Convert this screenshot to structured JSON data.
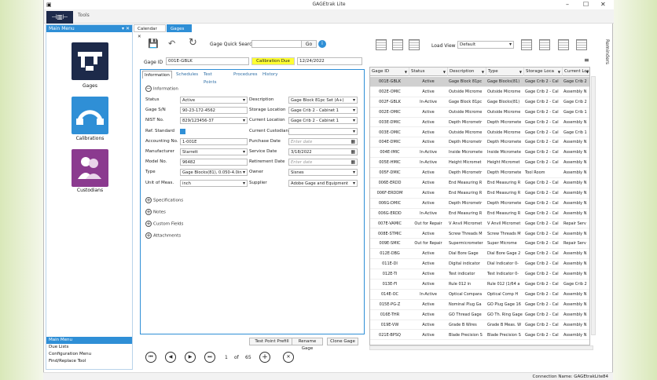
{
  "window": {
    "title": "GAGEtrak Lite",
    "minimize": "–",
    "maximize": "☐",
    "close": "✕"
  },
  "ribbon": {
    "tools_label": "Tools",
    "logo_glyph": "⊣▥⊢"
  },
  "main_menu": {
    "title": "Main Menu",
    "pin": "▾ ✕",
    "tiles": [
      {
        "label": "Gages",
        "color": "#1d2a4a"
      },
      {
        "label": "Calibrations",
        "color": "#2f8fd6"
      },
      {
        "label": "Custodians",
        "color": "#8b3a8f"
      }
    ],
    "links": [
      {
        "label": "Main Menu",
        "selected": true
      },
      {
        "label": "Due Lists"
      },
      {
        "label": "Configuration Menu"
      },
      {
        "label": "Find/Replace Tool"
      }
    ]
  },
  "doc_tabs": [
    {
      "label": "Calendar",
      "close": "✕"
    },
    {
      "label": "Gages",
      "close": "✕"
    }
  ],
  "toolbar": {
    "quick_search_label": "Gage Quick Search",
    "go_label": "Go",
    "info": "i",
    "load_view_label": "Load View",
    "load_view_value": "Default"
  },
  "header": {
    "gage_id_label": "Gage ID",
    "gage_id_value": "001E-GBLK",
    "cal_due_label": "Calibration Due",
    "cal_due_date": "12/24/2022"
  },
  "sub_tabs": [
    "Information",
    "Schedules",
    "Test Points",
    "Procedures",
    "History"
  ],
  "info_section": "Information",
  "fields_left": [
    {
      "label": "Status",
      "value": "Active",
      "kind": "sel"
    },
    {
      "label": "Gage S/N",
      "value": "90-23-172-4562",
      "kind": "txt"
    },
    {
      "label": "NIST No.",
      "value": "829/123456-37",
      "kind": "sel"
    },
    {
      "label": "Ref. Standard",
      "value": "",
      "kind": "chk"
    },
    {
      "label": "Accounting No.",
      "value": "1-001E",
      "kind": "txt"
    },
    {
      "label": "Manufacturer",
      "value": "Starrett",
      "kind": "sel"
    },
    {
      "label": "Model No.",
      "value": "96482",
      "kind": "txt"
    },
    {
      "label": "Type",
      "value": "Gage Blocks(81), 0.050-4.0in",
      "kind": "sel"
    },
    {
      "label": "Unit of Meas.",
      "value": "inch",
      "kind": "sel"
    }
  ],
  "fields_right": [
    {
      "label": "Description",
      "value": "Gage Block 81pc Set (A+)",
      "kind": "sel"
    },
    {
      "label": "Storage Location",
      "value": "Gage Crib 2 - Cabinet 1",
      "kind": "sel"
    },
    {
      "label": "Current Location",
      "value": "Gage Crib 2 - Cabinet 1",
      "kind": "sel"
    },
    {
      "label": "Current Custodian",
      "value": "",
      "kind": "sel"
    },
    {
      "label": "Purchase Date",
      "value": "Enter date",
      "kind": "dtph"
    },
    {
      "label": "Service Date",
      "value": "3/18/2022",
      "kind": "dt"
    },
    {
      "label": "Retirement Date",
      "value": "Enter date",
      "kind": "dtph"
    },
    {
      "label": "Owner",
      "value": "Sisnes",
      "kind": "sel"
    },
    {
      "label": "Supplier",
      "value": "Adobe Gage and Equipment",
      "kind": "sel"
    }
  ],
  "collapsed_sections": [
    "Specifications",
    "Notes",
    "Custom Fields",
    "Attachments"
  ],
  "bottom_buttons": [
    "Test Point Prefill",
    "Rename Gage",
    "Clone Gage"
  ],
  "pager": {
    "first": "⏮",
    "prev": "◀",
    "next": "▶",
    "last": "⏭",
    "current": "1",
    "of_label": "of",
    "total": "65",
    "add": "+",
    "delete": "✕"
  },
  "grid": {
    "columns": [
      "Gage ID",
      "Status",
      "Description",
      "Type",
      "Storage Loca",
      "Current Loc"
    ],
    "filter_glyph": "▼",
    "rows": [
      [
        "001E-GBLK",
        "Active",
        "Gage Block 81pc",
        "Gage Blocks(81)",
        "Gage Crib 2 - Cal",
        "Gage Crib 2"
      ],
      [
        "002E-OMIC",
        "Active",
        "Outside Microme",
        "Outside Microme",
        "Gage Crib 2 - Cal",
        "Assembly N"
      ],
      [
        "002F-GBLK",
        "In-Active",
        "Gage Block 81pc",
        "Gage Blocks(81)",
        "Gage Crib 2 - Cal",
        "Gage Crib 2"
      ],
      [
        "002E-OMIC",
        "Active",
        "Outside Microme",
        "Outside Microme",
        "Gage Crib 2 - Cal",
        "Gage Crib 1"
      ],
      [
        "003E-DMIC",
        "Active",
        "Depth Micrometr",
        "Depth Micromete",
        "Gage Crib 2 - Cal",
        "Assembly N"
      ],
      [
        "003E-OMIC",
        "Active",
        "Outside Microme",
        "Outside Microme",
        "Gage Crib 2 - Cal",
        "Gage Crib 1"
      ],
      [
        "004E-DMIC",
        "Active",
        "Depth Micrometr",
        "Depth Micromete",
        "Gage Crib 2 - Cal",
        "Assembly N"
      ],
      [
        "004E-IMIC",
        "In-Active",
        "Inside Micromete",
        "Inside Micromete",
        "Gage Crib 2 - Cal",
        "Assembly N"
      ],
      [
        "005E-HMIC",
        "In-Active",
        "Height Micromet",
        "Height Micromet",
        "Gage Crib 2 - Cal",
        "Assembly N"
      ],
      [
        "005F-DMIC",
        "Active",
        "Depth Micrometr",
        "Depth Micromete",
        "Tool Room",
        "Assembly N"
      ],
      [
        "006E-ERDD",
        "Active",
        "End Measuring R",
        "End Measuring R",
        "Gage Crib 2 - Cal",
        "Assembly N"
      ],
      [
        "006F-ERDDM",
        "Active",
        "End Measuring R",
        "End Measuring R",
        "Gage Crib 2 - Cal",
        "Assembly N"
      ],
      [
        "006G-DMIC",
        "Active",
        "Depth Micrometr",
        "Depth Micromete",
        "Gage Crib 2 - Cal",
        "Assembly N"
      ],
      [
        "006G-ERDD",
        "In-Active",
        "End Measuring R",
        "End Measuring R",
        "Gage Crib 2 - Cal",
        "Assembly N"
      ],
      [
        "007E-VAMIC",
        "Out for Repair",
        "V Anvil Micromet",
        "V Anvil Micromet",
        "Gage Crib 2 - Cal",
        "Repair Serv"
      ],
      [
        "008E-STMIC",
        "Active",
        "Screw Threads M",
        "Screw Threads M",
        "Gage Crib 2 - Cal",
        "Assembly N"
      ],
      [
        "009E-SMIC",
        "Out for Repair",
        "Supermicrometer",
        "Super Microme",
        "Gage Crib 2 - Cal",
        "Repair Serv"
      ],
      [
        "012E-DBG",
        "Active",
        "Dial Bore Gage",
        "Dial Bore Gage 2",
        "Gage Crib 2 - Cal",
        "Assembly N"
      ],
      [
        "011E-DI",
        "Active",
        "Digital indicator",
        "Dial Indicator 0-",
        "Gage Crib 2 - Cal",
        "Assembly N"
      ],
      [
        "012E-TI",
        "Active",
        "Test indicator",
        "Test Indicator 0-",
        "Gage Crib 2 - Cal",
        "Assembly N"
      ],
      [
        "013E-FI",
        "Active",
        "Rule 012 in",
        "Rule 012 (1/64 a",
        "Gage Crib 2 - Cal",
        "Gage Crib 2"
      ],
      [
        "014E-OC",
        "In-Active",
        "Optical Compara",
        "Optical Comp H",
        "Gage Crib 2 - Cal",
        "Assembly N"
      ],
      [
        "015E-PG-Z",
        "Active",
        "Nominal Plug Ga",
        "GO Plug Gage 16",
        "Gage Crib 2 - Cal",
        "Assembly N"
      ],
      [
        "016E-THR",
        "Active",
        "GO Thread Gage",
        "GO Th. Ring Gage",
        "Gage Crib 2 - Cal",
        "Assembly N"
      ],
      [
        "019E-VW",
        "Active",
        "Grade B Wires",
        "Grade B Meas. W",
        "Gage Crib 2 - Cal",
        "Assembly N"
      ],
      [
        "021E-BPSQ",
        "Active",
        "Blade Precision S",
        "Blade Precision S",
        "Gage Crib 2 - Cal",
        "Assembly N"
      ]
    ]
  },
  "reminders_label": "Reminders",
  "status_bar": {
    "connection": "Connection Name: GAGEtrakLite84"
  },
  "colors": {
    "accent": "#2f8fd6",
    "cal_due_bg": "#ffff33"
  }
}
